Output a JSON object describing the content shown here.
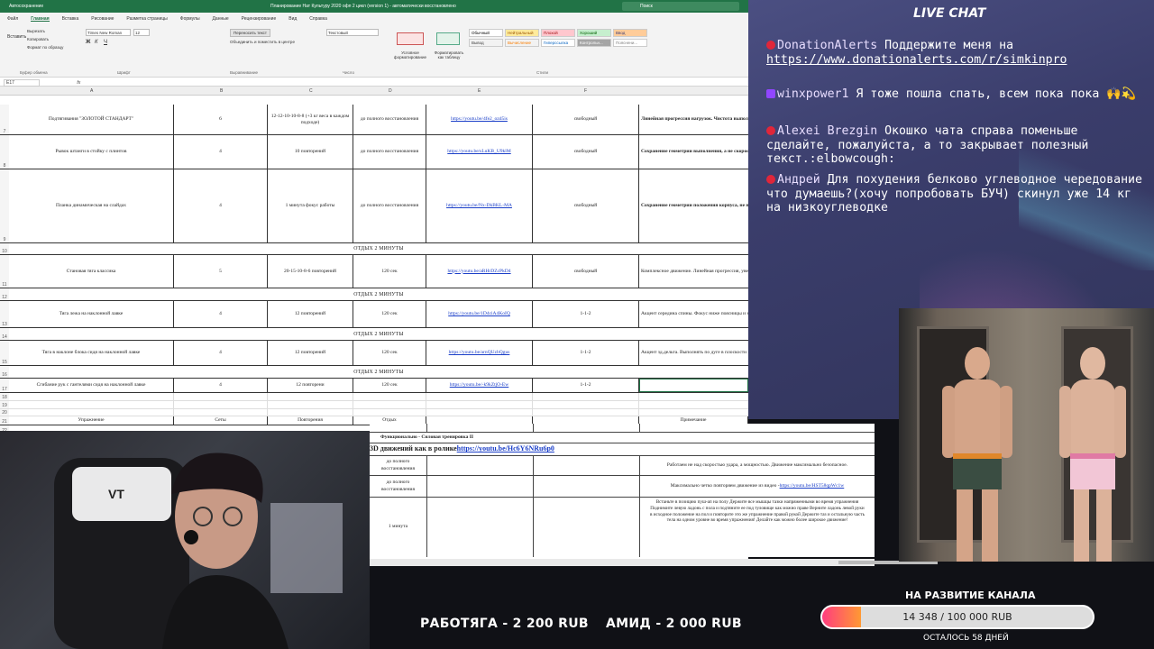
{
  "excel": {
    "autosave_label": "Автосохранение",
    "doc_title": "Планирование Нат Культуру 2020 офп 2 цикл (version 1) - автоматически восстановлено",
    "search_placeholder": "Поиск",
    "tabs": [
      "Файл",
      "Главная",
      "Вставка",
      "Рисование",
      "Разметка страницы",
      "Формулы",
      "Данные",
      "Рецензирование",
      "Вид",
      "Справка"
    ],
    "active_tab": "Главная",
    "ribbon": {
      "paste": "Вставить",
      "cut": "Вырезать",
      "copy": "Копировать",
      "format_painter": "Формат по образцу",
      "clipboard": "Буфер обмена",
      "font_name": "Times New Roman",
      "font_size": "12",
      "font_group": "Шрифт",
      "wrap_text": "Переносить текст",
      "merge": "Объединить и поместить в центре",
      "alignment_group": "Выравнивание",
      "number_format": "Текстовый",
      "number_group": "Число",
      "cond_format": "Условное форматирование",
      "format_table": "Форматировать как таблицу",
      "styles_group": "Стили",
      "styles": [
        {
          "name": "Обычный",
          "bg": "#ffffff",
          "fg": "#000000"
        },
        {
          "name": "Нейтральный",
          "bg": "#ffeb9c",
          "fg": "#9c5700"
        },
        {
          "name": "Плохой",
          "bg": "#ffc7ce",
          "fg": "#9c0006"
        },
        {
          "name": "Хороший",
          "bg": "#c6efce",
          "fg": "#006100"
        },
        {
          "name": "Ввод",
          "bg": "#ffcc99",
          "fg": "#3f3f76"
        },
        {
          "name": "Вывод",
          "bg": "#f2f2f2",
          "fg": "#3f3f3f"
        },
        {
          "name": "Вычисление",
          "bg": "#f2f2f2",
          "fg": "#fa7d00"
        },
        {
          "name": "Гиперссылка",
          "bg": "#ffffff",
          "fg": "#0563c1"
        },
        {
          "name": "Контрольн...",
          "bg": "#a5a5a5",
          "fg": "#ffffff"
        },
        {
          "name": "Пояснени...",
          "bg": "#ffffff",
          "fg": "#7f7f7f"
        }
      ]
    },
    "name_box": "E17",
    "columns": [
      "A",
      "B",
      "C",
      "D",
      "E",
      "F"
    ],
    "rows": [
      {
        "n": "7",
        "a": "Подтягивания \"ЗОЛОТОЙ СТАНДАРТ\"",
        "b": "6",
        "c": "12-12-10-10-8-8 (+3 кг веса в каждом подходе)",
        "d": "до полного восстановления",
        "e": "https://youtu.be/4fe2_ozd5is",
        "f": "свободный",
        "g": "Линейная прогрессия нагрузок. Чистота выполнения \"ЗОЛОТОЙ СТАНДАРТ\" (прямой, обратный)"
      },
      {
        "n": "8",
        "a": "Рывок штанги в стойку с плинтов",
        "b": "4",
        "c": "10 повторений",
        "d": "до полного восстановления",
        "e": "https://youtu.be/sLuKB_U9klM",
        "f": "свободный",
        "g": "Сохранение геометрии выполнения, а не скорость выполнения"
      },
      {
        "n": "9",
        "a": "Планка динамическая на слайдах",
        "b": "4",
        "c": "1 минута фокус работы",
        "d": "до полного восстановления",
        "e": "https://youtu.be/Nx-DkBKL-MA",
        "f": "свободный",
        "g": "Сохранение геометрии положения корпуса, не проваливаем и не задираем таз"
      },
      {
        "n": "11",
        "a": "Становая тяга классика",
        "b": "5",
        "c": "20-15-10-8-6 повторений",
        "d": "120 сек",
        "e": "https://youtu.be/aRHrDZcPkD4",
        "f": "свободный",
        "g": "Комплексное движение. Линейная прогрессия, увеличить вес составляющую. Обязательно до конца работы. ТЕМП - свободный, выполнить"
      },
      {
        "n": "13",
        "a": "Тяга лежа на наклонной лавке",
        "b": "4",
        "c": "12 повторений",
        "d": "120 сек",
        "e": "https://youtu.be/1D4ciA4KoIQ",
        "f": "1-1-2",
        "g": "Акцент середина спины. Фокус ниже поясницы и не отрывать грудь от лавки"
      },
      {
        "n": "15",
        "a": "Тяга в наклоне блока сидя на наклонной лавке",
        "b": "4",
        "c": "12 повторений",
        "d": "120 сек",
        "e": "https://youtu.be/arnQUzbQgus",
        "f": "1-1-2",
        "g": "Акцент зд.дельта. Выполнять по дуге в плоскости зд.дельты. Не сводить"
      },
      {
        "n": "17",
        "a": "Сгибание рук с гантелями сидя на наклонной лавке",
        "b": "4",
        "c": "12 повторени",
        "d": "120 сек",
        "e": "https://youtu.be/-k9kZtjO-Ew",
        "f": "1-1-2",
        "g": ""
      }
    ],
    "rest_rows": [
      {
        "n": "10",
        "text": "ОТДЫХ  2 МИНУТЫ"
      },
      {
        "n": "12",
        "text": "ОТДЫХ 2 МИНУТЫ"
      },
      {
        "n": "14",
        "text": "ОТДЫХ 2 МИНУТЫ"
      },
      {
        "n": "16",
        "text": "ОТДЫХ 2 МИНУТЫ"
      }
    ],
    "header_row": {
      "n": "21",
      "a": "Упражнение",
      "b": "Сеты",
      "c": "Повторения",
      "d": "Отдых",
      "g": "Примечание"
    },
    "section_title": {
      "n": "22",
      "text": "Функционально - Силовая тренировка II"
    },
    "empty_rows": [
      "18",
      "19",
      "20"
    ],
    "sheet2": {
      "title": "3D движений как в ролике ",
      "title_link": "https://youtu.be/Hc6Y6NRu6p0",
      "rows": [
        {
          "d": "до полного восстановления",
          "note": "Работаем не над скоростью удара, а мощностью. Движение максимально безопасное."
        },
        {
          "d": "до полного восстановления",
          "note": "Максимально четко повторяем движение из видео - ",
          "link": "https://youtu.be/HST58qpWc1w"
        },
        {
          "d": "1 минута",
          "note": "Встаньте в позицию пуш-ап на полу Держите все мышцы тазки напряженными во время упражнения Поднимите левую ладонь с пола и подтяните ее под туловище как можно праве Верните ладонь левой руки в исходное положение на пол и повторите это же упражнение правой рукой Держите таз и остальную часть тела на одном уровне во время упражнения! Делайте как можно более широкое движение!"
        }
      ]
    }
  },
  "chat": {
    "title": "LIVE CHAT",
    "messages": [
      {
        "source": "donationalerts",
        "author": "DonationAlerts",
        "text": "Поддержите меня на ",
        "link": "https://www.donationalerts.com/r/simkinpro"
      },
      {
        "source": "twitch",
        "author": "winxpower1",
        "text": "Я тоже пошла спать, всем пока пока 🙌💫"
      },
      {
        "source": "youtube",
        "author": "Alexei Brezgin",
        "text": "Окошко чата справа поменьше сделайте, пожалуйста, а то закрывает полезный текст.:elbowcough:"
      },
      {
        "source": "youtube",
        "author": "Андрей",
        "text": "Для похудения белково углеводное чередование что думаешь?(хочу попробовать БУЧ) скинул уже 14 кг на низкоуглеводке"
      }
    ]
  },
  "donors": [
    {
      "name": "РАБОТЯГА",
      "amount": "- 2 200 RUB"
    },
    {
      "name": "АМИД",
      "amount": "- 2 000 RUB"
    }
  ],
  "goal": {
    "title": "НА РАЗВИТИЕ КАНАЛА",
    "text": "14 348 / 100 000 RUB",
    "progress": 0.1435,
    "remaining": "ОСТАЛОСЬ 58 ДНЕЙ"
  }
}
